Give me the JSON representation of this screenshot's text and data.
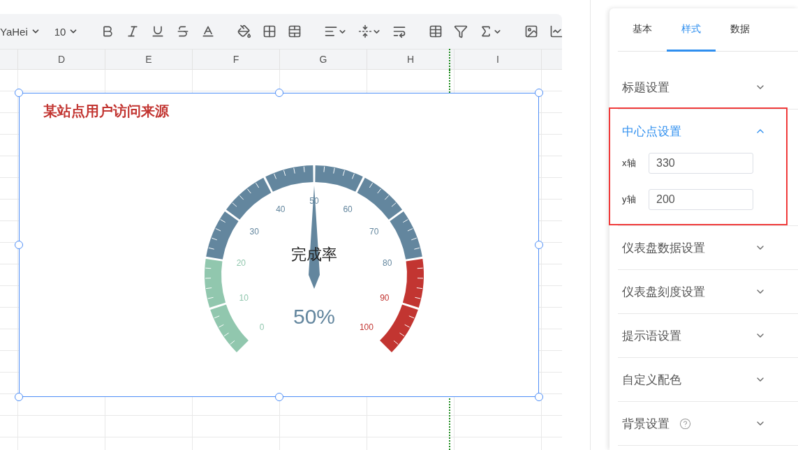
{
  "toolbar": {
    "font": "YaHei",
    "font_size": "10"
  },
  "columns": [
    "D",
    "E",
    "F",
    "G",
    "H",
    "I"
  ],
  "chart": {
    "title": "某站点用户访问来源",
    "gauge": {
      "name": "完成率",
      "value_text": "50%",
      "labels": [
        {
          "text": "0",
          "color": "#91c7ae"
        },
        {
          "text": "10",
          "color": "#91c7ae"
        },
        {
          "text": "20",
          "color": "#91c7ae"
        },
        {
          "text": "30",
          "color": "#63869e"
        },
        {
          "text": "40",
          "color": "#63869e"
        },
        {
          "text": "50",
          "color": "#63869e"
        },
        {
          "text": "60",
          "color": "#63869e"
        },
        {
          "text": "70",
          "color": "#63869e"
        },
        {
          "text": "80",
          "color": "#63869e"
        },
        {
          "text": "90",
          "color": "#c23531"
        },
        {
          "text": "100",
          "color": "#c23531"
        }
      ]
    }
  },
  "panel": {
    "tabs": [
      {
        "label": "基本",
        "selected": false
      },
      {
        "label": "样式",
        "selected": true
      },
      {
        "label": "数据",
        "selected": false
      }
    ],
    "sections": [
      {
        "title": "标题设置",
        "expanded": false,
        "highlighted": false,
        "help": false
      },
      {
        "title": "中心点设置",
        "expanded": true,
        "highlighted": true,
        "help": false,
        "fields": [
          {
            "label": "x轴",
            "value": "330"
          },
          {
            "label": "y轴",
            "value": "200"
          }
        ]
      },
      {
        "title": "仪表盘数据设置",
        "expanded": false,
        "highlighted": false,
        "help": false
      },
      {
        "title": "仪表盘刻度设置",
        "expanded": false,
        "highlighted": false,
        "help": false
      },
      {
        "title": "提示语设置",
        "expanded": false,
        "highlighted": false,
        "help": false
      },
      {
        "title": "自定义配色",
        "expanded": false,
        "highlighted": false,
        "help": false
      },
      {
        "title": "背景设置",
        "expanded": false,
        "highlighted": false,
        "help": true
      }
    ]
  }
}
